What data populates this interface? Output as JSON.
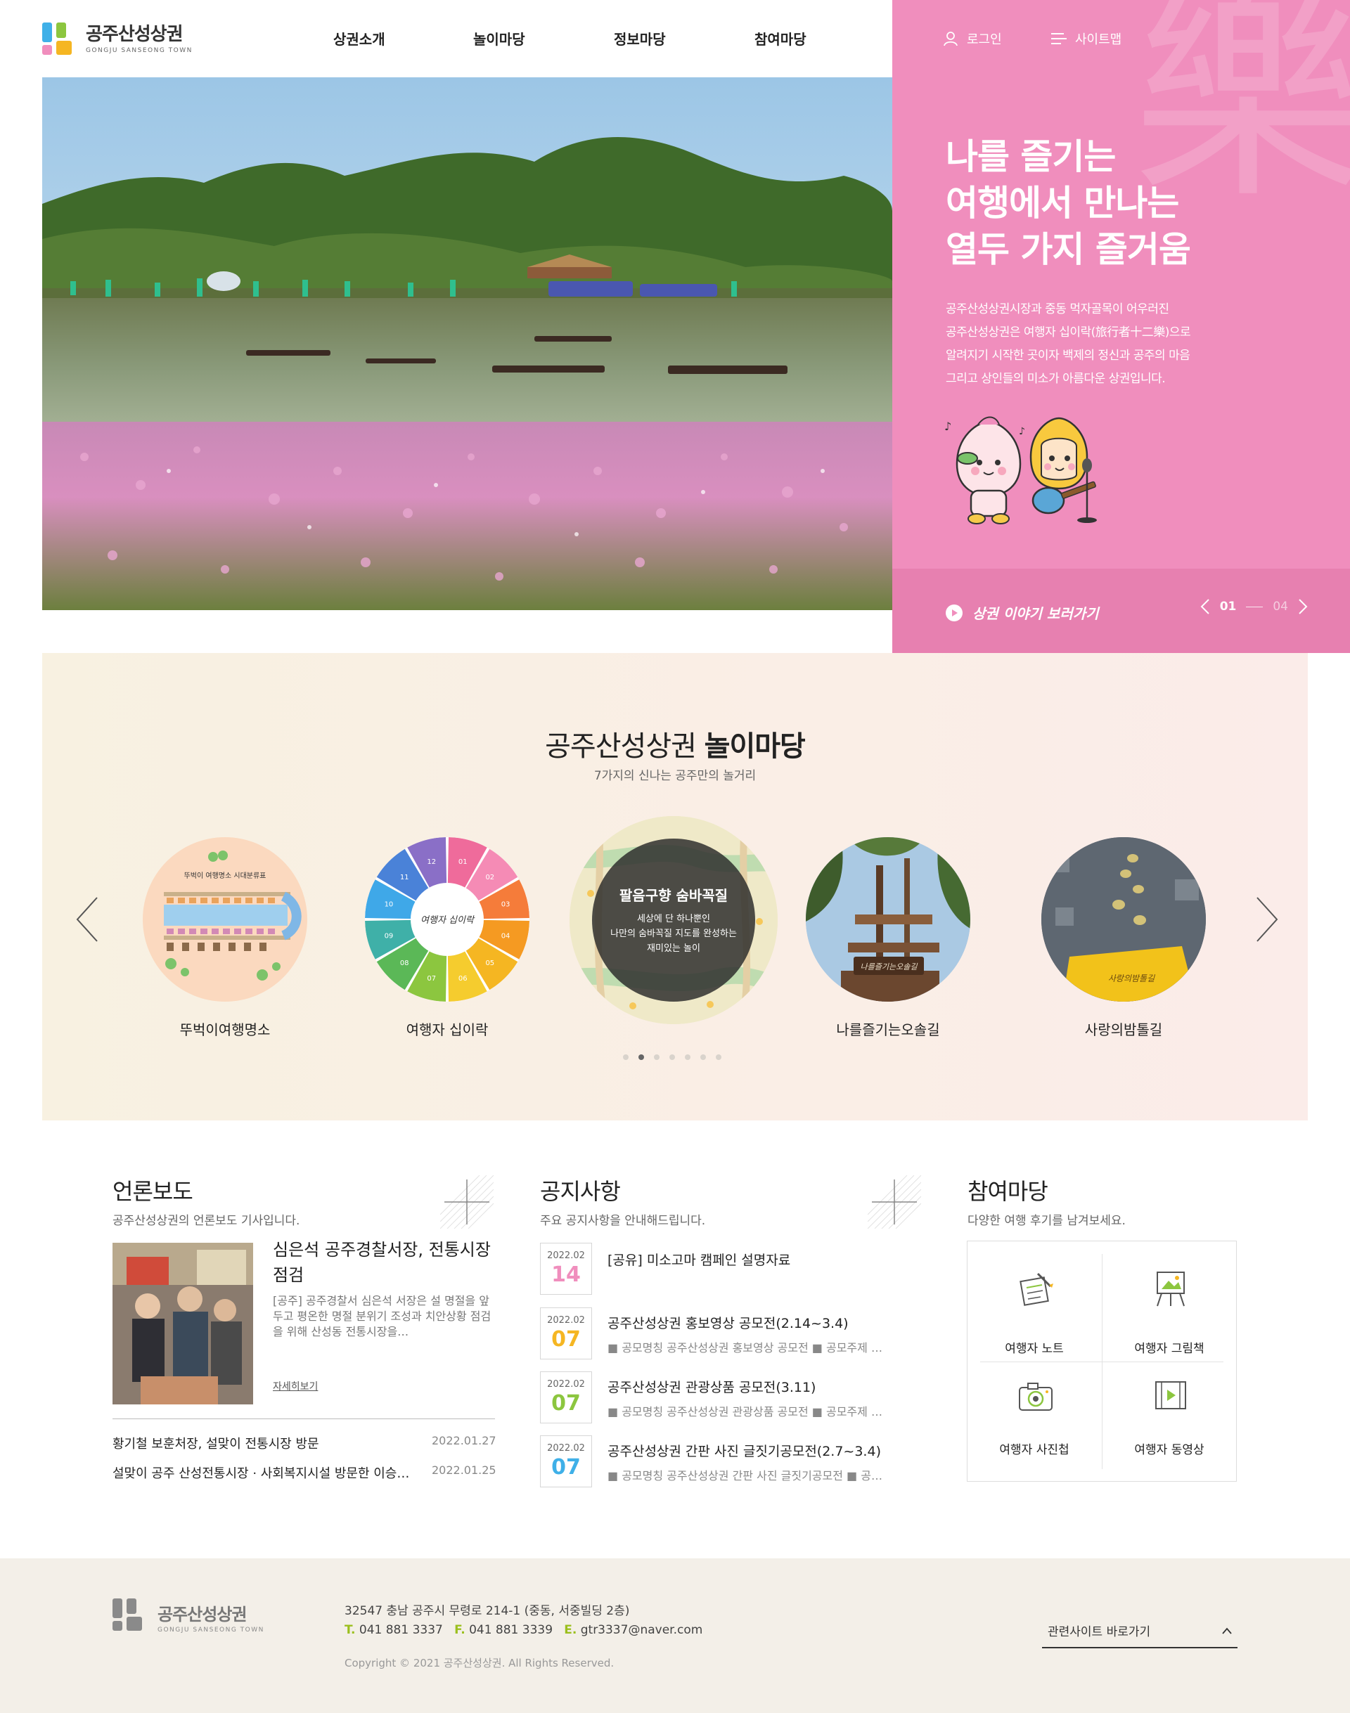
{
  "header": {
    "logo_ko": "공주산성상권",
    "logo_en": "GONGJU SANSEONG TOWN",
    "nav": [
      "상권소개",
      "놀이마당",
      "정보마당",
      "참여마당"
    ],
    "login": "로그인",
    "sitemap": "사이트맵"
  },
  "hero": {
    "bg_char": "樂",
    "title_lines": [
      "나를 즐기는",
      "여행에서 만나는",
      "열두 가지 즐거움"
    ],
    "desc_lines": [
      "공주산성상권시장과 중동 먹자골목이 어우러진",
      "공주산성상권은 여행자 십이락(旅行者十二樂)으로",
      "알려지기 시작한 곳이자 백제의 정신과 공주의 마음",
      "그리고 상인들의 미소가 아름다운 상권입니다."
    ],
    "story_link": "상권 이야기 보러가기",
    "page_current": "01",
    "page_total": "04",
    "panel_color": "#f08ebd"
  },
  "play": {
    "title_light": "공주산성상권",
    "title_bold": "놀이마당",
    "subtitle": "7가지의 신나는 공주만의 놀거리",
    "map_card_text": "뚜벅이 여행명소 시대분류표",
    "wheel_center": "여행자 십이락",
    "wheel_numbers": [
      "01",
      "02",
      "03",
      "04",
      "05",
      "06",
      "07",
      "08",
      "09",
      "10",
      "11",
      "12"
    ],
    "featured_title": "팔음구향 숨바꼭질",
    "featured_desc": [
      "세상에 단 하나뿐인",
      "나만의 숨바꼭질 지도를 완성하는",
      "재미있는 놀이"
    ],
    "sign_text": "나를즐기는오솔길",
    "mat_text": "사랑의밤톨길",
    "items": [
      "뚜벅이여행명소",
      "여행자 십이락",
      "나를즐기는오솔길",
      "사랑의밤톨길"
    ],
    "active_dot": 2,
    "dot_count": 7
  },
  "news": {
    "title": "언론보도",
    "subtitle": "공주산성상권의 언론보도 기사입니다.",
    "feature_title": "심은석 공주경찰서장, 전통시장 점검",
    "feature_desc": "[공주] 공주경찰서 심은석 서장은 설 명절을 앞두고 평온한 명절 분위기 조성과 치안상황 점검을 위해 산성동 전통시장을…",
    "more": "자세히보기",
    "list": [
      {
        "title": "황기철 보훈처장, 설맞이 전통시장 방문",
        "date": "2022.01.27"
      },
      {
        "title": "설맞이 공주 산성전통시장 · 사회복지시설 방문한 이승…",
        "date": "2022.01.25"
      }
    ]
  },
  "notice": {
    "title": "공지사항",
    "subtitle": "주요 공지사항을 안내해드립니다.",
    "items": [
      {
        "ym": "2022.02",
        "day": "14",
        "title": "[공유] 미소고마 캠페인 설명자료",
        "meta": "",
        "color": "#f08ebd"
      },
      {
        "ym": "2022.02",
        "day": "07",
        "title": "공주산성상권 홍보영상 공모전(2.14~3.4)",
        "meta": "■ 공모명칭 공주산성상권 홍보영상 공모전   ■ 공모주제 …",
        "color": "#f5b622"
      },
      {
        "ym": "2022.02",
        "day": "07",
        "title": "공주산성상권 관광상품 공모전(3.11)",
        "meta": "■ 공모명칭 공주산성상권 관광상품 공모전   ■ 공모주제 …",
        "color": "#8cc63f"
      },
      {
        "ym": "2022.02",
        "day": "07",
        "title": "공주산성상권 간판 사진 글짓기공모전(2.7~3.4)",
        "meta": "■ 공모명칭 공주산성상권 간판 사진 글짓기공모전   ■ 공…",
        "color": "#3fb0e8"
      }
    ]
  },
  "participation": {
    "title": "참여마당",
    "subtitle": "다양한 여행 후기를 남겨보세요.",
    "items": [
      {
        "label": "여행자 노트",
        "icon": "note-icon"
      },
      {
        "label": "여행자 그림책",
        "icon": "easel-icon"
      },
      {
        "label": "여행자 사진첩",
        "icon": "camera-icon"
      },
      {
        "label": "여행자 동영상",
        "icon": "video-icon"
      }
    ]
  },
  "footer": {
    "logo_ko": "공주산성상권",
    "logo_en": "GONGJU SANSEONG TOWN",
    "address": "32547 충남 공주시 무령로 214-1 (중동, 서중빌딩 2층)",
    "tel_label": "T.",
    "tel": "041 881 3337",
    "fax_label": "F.",
    "fax": "041 881 3339",
    "email_label": "E.",
    "email": "gtr3337@naver.com",
    "copyright": "Copyright © 2021 공주산성상권. All Rights Reserved.",
    "related_sites": "관련사이트 바로가기"
  }
}
